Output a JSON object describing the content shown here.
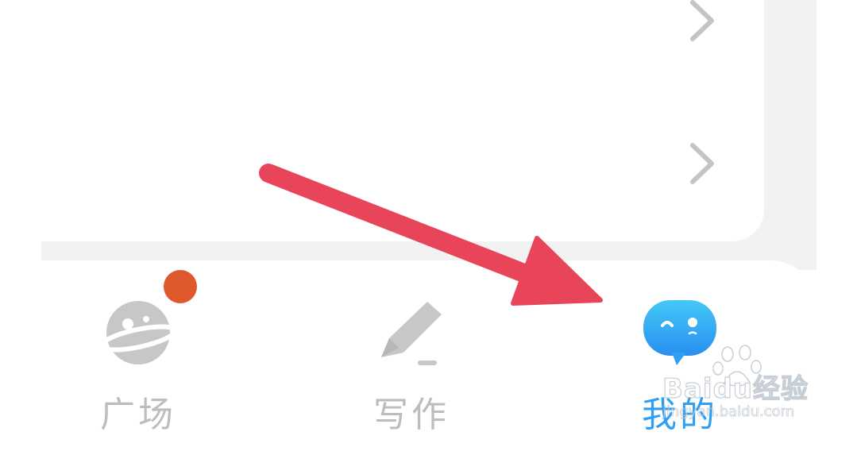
{
  "list": {
    "rows": [
      {
        "chevron_icon": "chevron-right-icon"
      },
      {
        "chevron_icon": "chevron-right-icon"
      }
    ]
  },
  "tabbar": {
    "tabs": [
      {
        "label": "广场",
        "icon": "planet-icon",
        "active": false,
        "badge_dot": true
      },
      {
        "label": "写作",
        "icon": "pencil-icon",
        "active": false,
        "badge_dot": false
      },
      {
        "label": "我的",
        "icon": "chat-bubble-face-icon",
        "active": true,
        "badge_dot": false
      }
    ]
  },
  "annotation": {
    "arrow_color": "#e8455a",
    "points_to": "tab-mine"
  },
  "watermark": {
    "brand": "Baidu经验",
    "url": "jingyan.baidu.com"
  },
  "colors": {
    "accent": "#2e9ff3",
    "inactive": "#bdbdbd",
    "badge": "#e0592d",
    "background_band": "#f2f2f2"
  }
}
